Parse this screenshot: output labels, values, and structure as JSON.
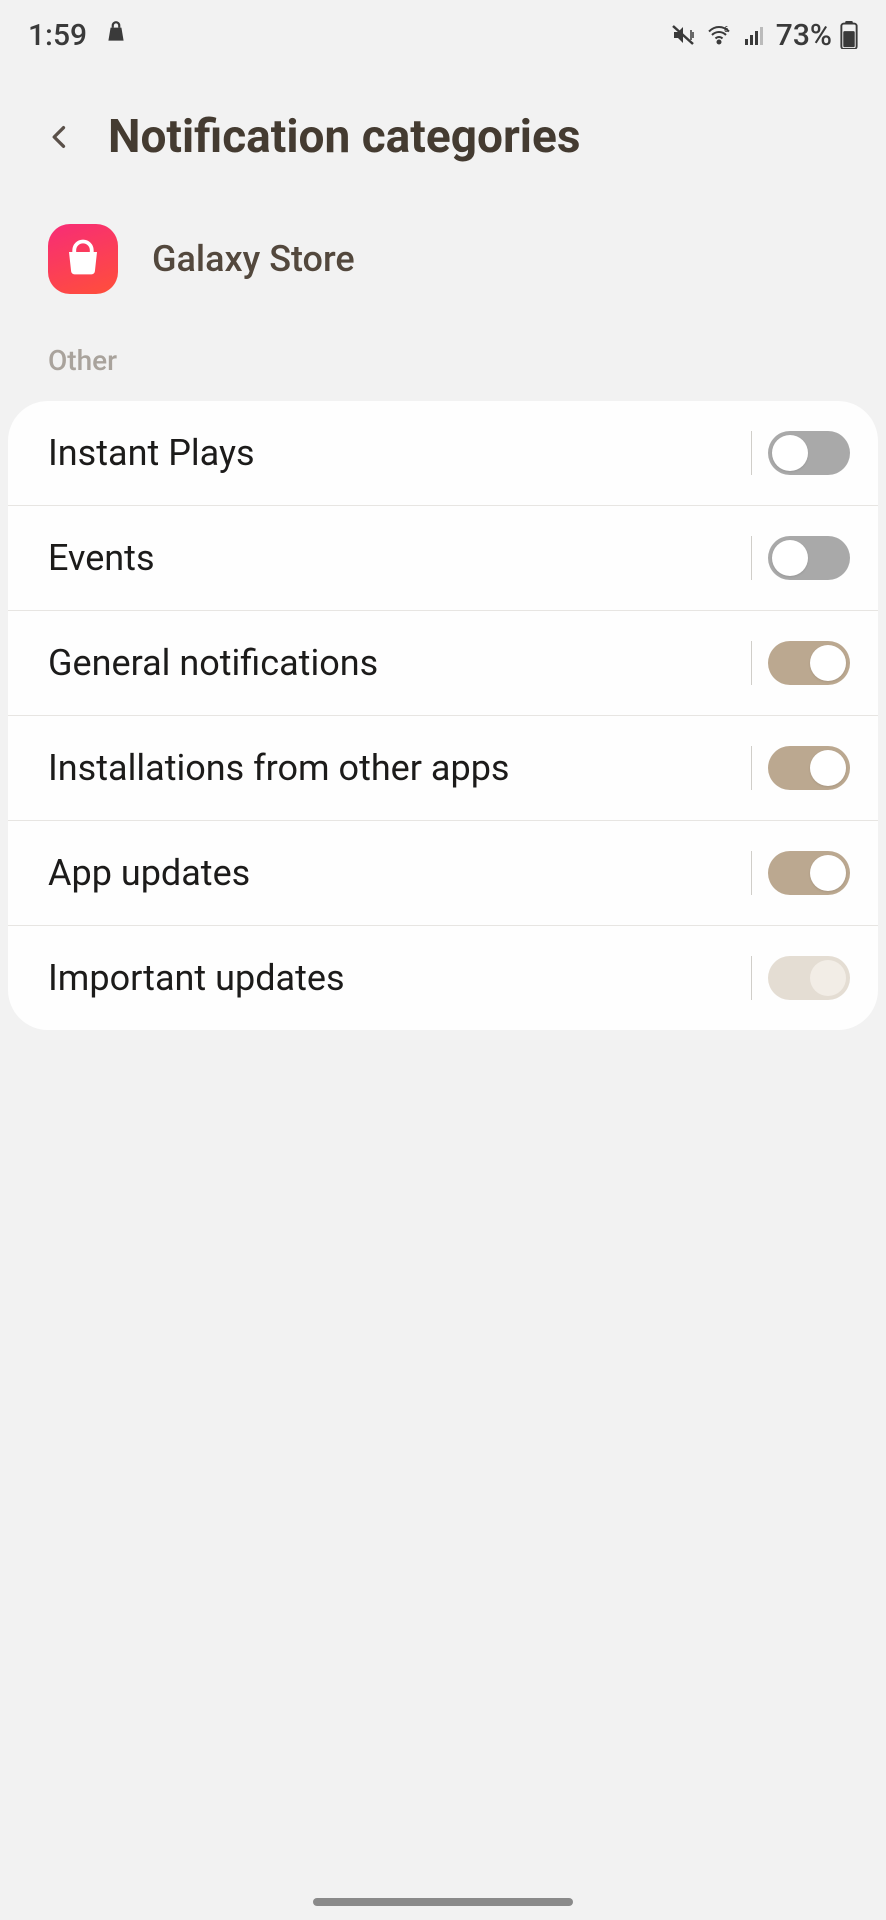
{
  "status": {
    "time": "1:59",
    "battery": "73%"
  },
  "header": {
    "title": "Notification categories"
  },
  "app": {
    "name": "Galaxy Store"
  },
  "section": {
    "label": "Other"
  },
  "items": [
    {
      "label": "Instant Plays",
      "state": "off"
    },
    {
      "label": "Events",
      "state": "off"
    },
    {
      "label": "General notifications",
      "state": "on"
    },
    {
      "label": "Installations from other apps",
      "state": "on"
    },
    {
      "label": "App updates",
      "state": "on"
    },
    {
      "label": "Important updates",
      "state": "on-disabled"
    }
  ]
}
